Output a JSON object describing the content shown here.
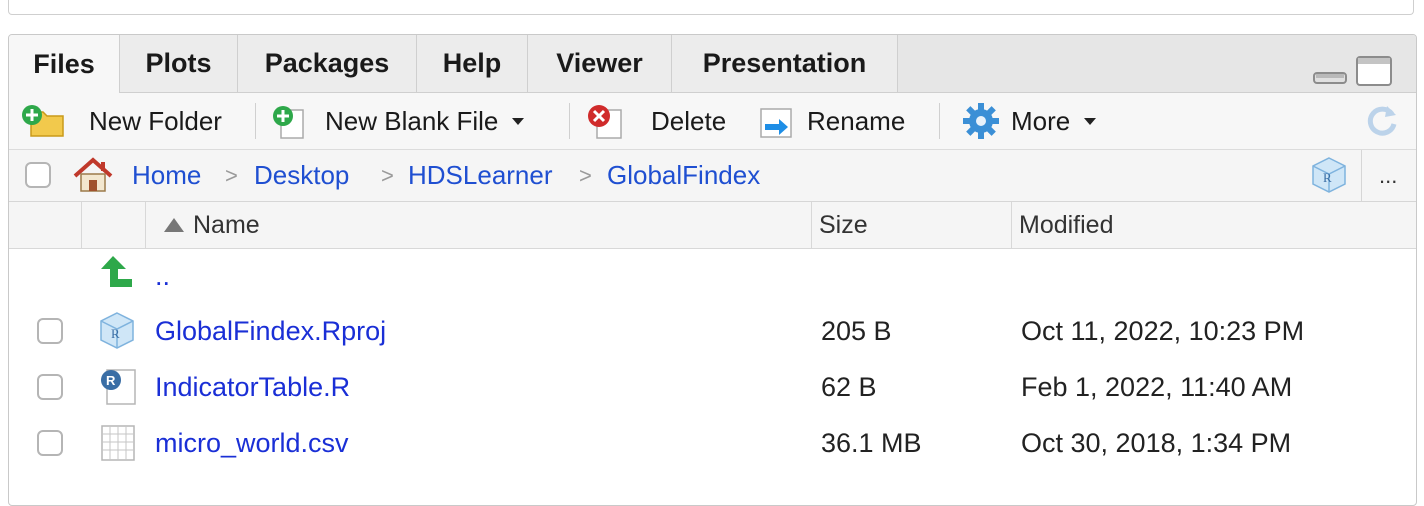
{
  "tabs": [
    {
      "label": "Files",
      "active": true
    },
    {
      "label": "Plots"
    },
    {
      "label": "Packages"
    },
    {
      "label": "Help"
    },
    {
      "label": "Viewer"
    },
    {
      "label": "Presentation"
    }
  ],
  "toolbar": {
    "new_folder": "New Folder",
    "new_blank_file": "New Blank File",
    "delete": "Delete",
    "rename": "Rename",
    "more": "More"
  },
  "breadcrumb": [
    "Home",
    "Desktop",
    "HDSLearner",
    "GlobalFindex"
  ],
  "more_dots": "...",
  "columns": {
    "name": "Name",
    "size": "Size",
    "modified": "Modified"
  },
  "parent_dir": "..",
  "files": [
    {
      "name": "GlobalFindex.Rproj",
      "size": "205 B",
      "modified": "Oct 11, 2022, 10:23 PM",
      "icon": "rproj-icon"
    },
    {
      "name": "IndicatorTable.R",
      "size": "62 B",
      "modified": "Feb 1, 2022, 11:40 AM",
      "icon": "r-file-icon"
    },
    {
      "name": "micro_world.csv",
      "size": "36.1 MB",
      "modified": "Oct 30, 2018, 1:34 PM",
      "icon": "csv-file-icon"
    }
  ],
  "colors": {
    "link": "#1a2fd6",
    "accent_green": "#2ea84a",
    "delete_red": "#d02b2b"
  }
}
